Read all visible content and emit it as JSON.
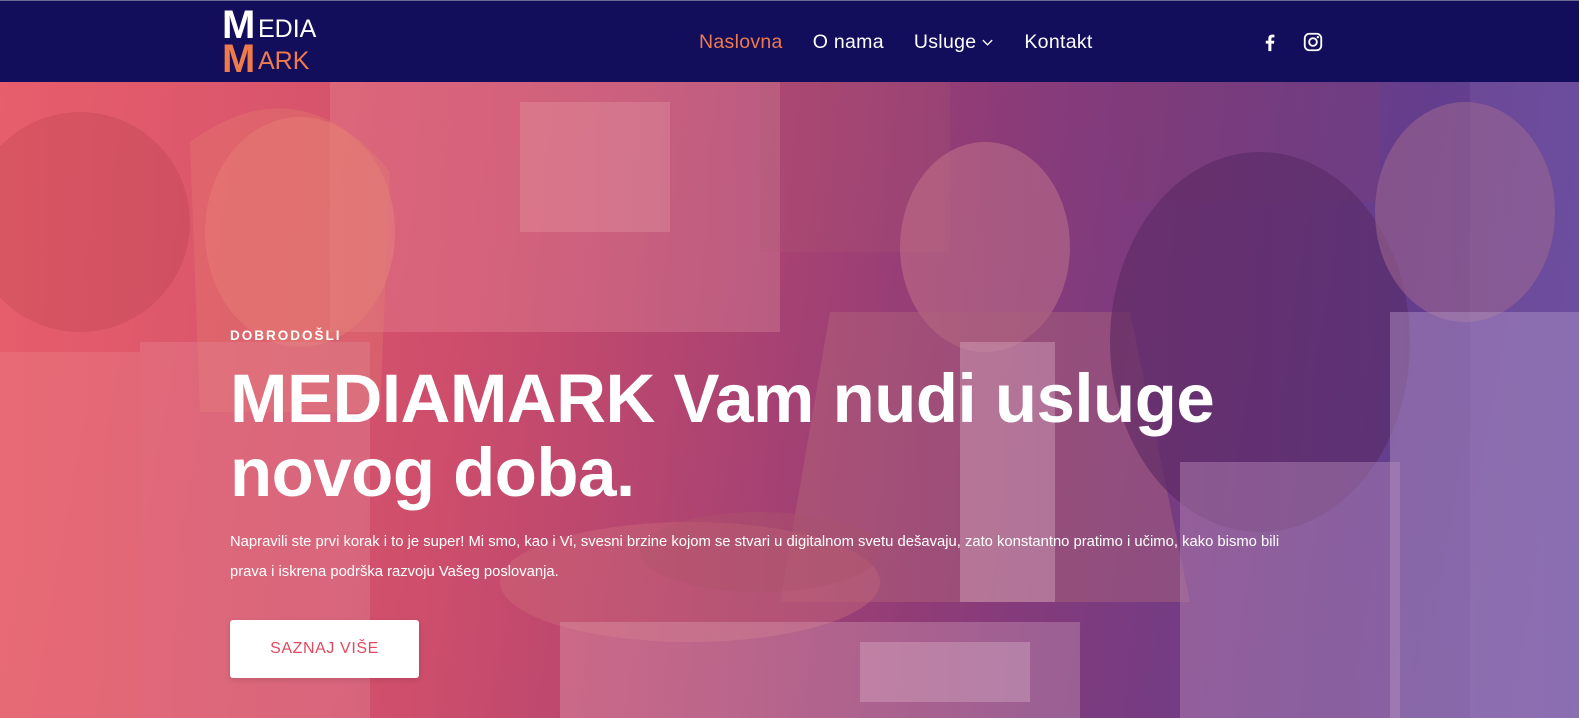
{
  "colors": {
    "header_bg": "#120e5c",
    "accent": "#ef7a4b",
    "cta_text": "#e2485f",
    "hero_gradient_start": "#e15d6c",
    "hero_gradient_end": "#5f3a8c"
  },
  "logo": {
    "line1_initial": "M",
    "line1_rest": "EDIA",
    "line2_initial": "M",
    "line2_rest": "ARK"
  },
  "nav": {
    "items": [
      {
        "label": "Naslovna",
        "active": true
      },
      {
        "label": "O nama",
        "active": false
      },
      {
        "label": "Usluge",
        "active": false,
        "has_dropdown": true,
        "icon": "chevron-down-icon"
      },
      {
        "label": "Kontakt",
        "active": false
      }
    ]
  },
  "social": {
    "icons": [
      "facebook-icon",
      "instagram-icon"
    ]
  },
  "hero": {
    "eyebrow": "DOBRODOŠLI",
    "headline_line1": "MEDIAMARK Vam nudi usluge",
    "headline_line2": "novog doba.",
    "lead_line1": "Napravili ste prvi korak i to je super! Mi smo, kao i Vi, svesni brzine kojom se stvari u digitalnom svetu dešavaju, zato konstantno pratimo i učimo, kako bismo bili",
    "lead_line2": "prava i iskrena podrška razvoju Vašeg poslovanja.",
    "cta_label": "SAZNAJ VIŠE"
  }
}
